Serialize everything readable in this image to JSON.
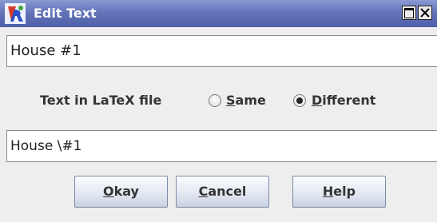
{
  "window": {
    "title": "Edit Text"
  },
  "text_field": {
    "value": "House #1"
  },
  "latex_option": {
    "label": "Text in LaTeX file",
    "same": {
      "mnemonic": "S",
      "rest": "ame",
      "checked": false
    },
    "different": {
      "mnemonic": "D",
      "rest": "ifferent",
      "checked": true
    }
  },
  "latex_field": {
    "value": "House \\#1"
  },
  "buttons": {
    "okay": {
      "mnemonic": "O",
      "rest": "kay"
    },
    "cancel": {
      "mnemonic": "C",
      "rest": "ancel"
    },
    "help": {
      "mnemonic": "H",
      "rest": "elp"
    }
  },
  "icons": {
    "app": "app-logo-icon",
    "maximize": "maximize-icon",
    "close": "close-icon"
  }
}
